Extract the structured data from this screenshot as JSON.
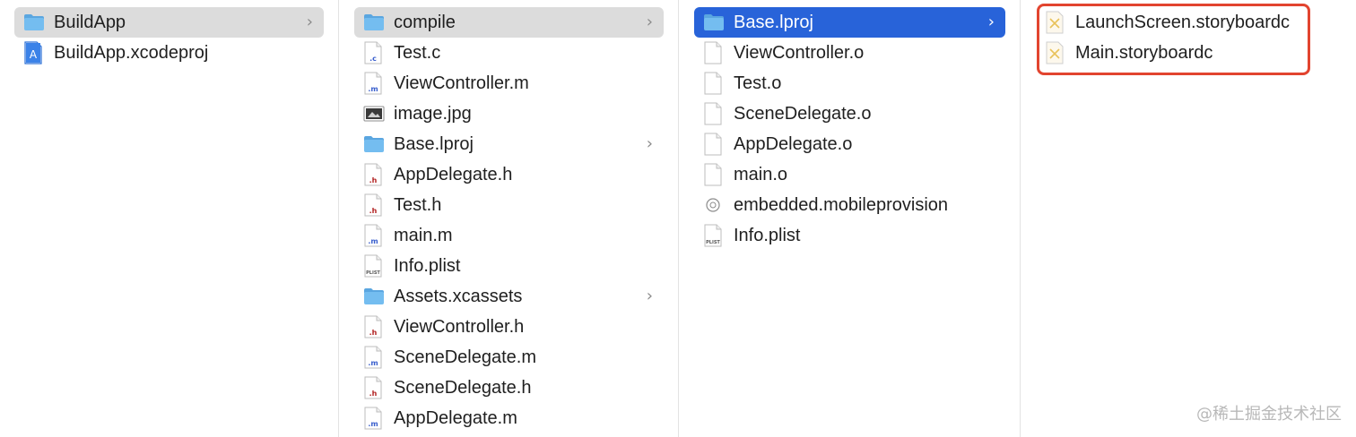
{
  "columns": [
    {
      "items": [
        {
          "label": "BuildApp",
          "icon": "folder-icon",
          "type": "folder",
          "state": "selected"
        },
        {
          "label": "BuildApp.xcodeproj",
          "icon": "xcodeproj-icon",
          "type": "xcodeproj"
        }
      ]
    },
    {
      "items": [
        {
          "label": "compile",
          "icon": "folder-icon",
          "type": "folder",
          "state": "selected"
        },
        {
          "label": "Test.c",
          "icon": "c-file-icon",
          "type": "c",
          "badge": ".c"
        },
        {
          "label": "ViewController.m",
          "icon": "m-file-icon",
          "type": "m",
          "badge": ".m"
        },
        {
          "label": "image.jpg",
          "icon": "image-file-icon",
          "type": "image"
        },
        {
          "label": "Base.lproj",
          "icon": "folder-icon",
          "type": "folder"
        },
        {
          "label": "AppDelegate.h",
          "icon": "h-file-icon",
          "type": "h",
          "badge": ".h"
        },
        {
          "label": "Test.h",
          "icon": "h-file-icon",
          "type": "h",
          "badge": ".h"
        },
        {
          "label": "main.m",
          "icon": "m-file-icon",
          "type": "m",
          "badge": ".m"
        },
        {
          "label": "Info.plist",
          "icon": "plist-file-icon",
          "type": "plist",
          "badge": "PLIST"
        },
        {
          "label": "Assets.xcassets",
          "icon": "folder-icon",
          "type": "folder"
        },
        {
          "label": "ViewController.h",
          "icon": "h-file-icon",
          "type": "h",
          "badge": ".h"
        },
        {
          "label": "SceneDelegate.m",
          "icon": "m-file-icon",
          "type": "m",
          "badge": ".m"
        },
        {
          "label": "SceneDelegate.h",
          "icon": "h-file-icon",
          "type": "h",
          "badge": ".h"
        },
        {
          "label": "AppDelegate.m",
          "icon": "m-file-icon",
          "type": "m",
          "badge": ".m"
        }
      ]
    },
    {
      "items": [
        {
          "label": "Base.lproj",
          "icon": "folder-icon",
          "type": "folder",
          "state": "active"
        },
        {
          "label": "ViewController.o",
          "icon": "object-file-icon",
          "type": "blank"
        },
        {
          "label": "Test.o",
          "icon": "object-file-icon",
          "type": "blank"
        },
        {
          "label": "SceneDelegate.o",
          "icon": "object-file-icon",
          "type": "blank"
        },
        {
          "label": "AppDelegate.o",
          "icon": "object-file-icon",
          "type": "blank"
        },
        {
          "label": "main.o",
          "icon": "object-file-icon",
          "type": "blank"
        },
        {
          "label": "embedded.mobileprovision",
          "icon": "provision-file-icon",
          "type": "provision"
        },
        {
          "label": "Info.plist",
          "icon": "plist-file-icon",
          "type": "plist",
          "badge": "PLIST"
        }
      ]
    },
    {
      "items": [
        {
          "label": "LaunchScreen.storyboardc",
          "icon": "storyboard-icon",
          "type": "storyboard"
        },
        {
          "label": "Main.storyboardc",
          "icon": "storyboard-icon",
          "type": "storyboard"
        }
      ]
    }
  ],
  "watermark": "@稀土掘金技术社区",
  "colors": {
    "selection_active": "#2863d9",
    "selection_inactive": "#dcdcdc",
    "highlight_border": "#e2442f",
    "folder": "#6cb5ea"
  }
}
